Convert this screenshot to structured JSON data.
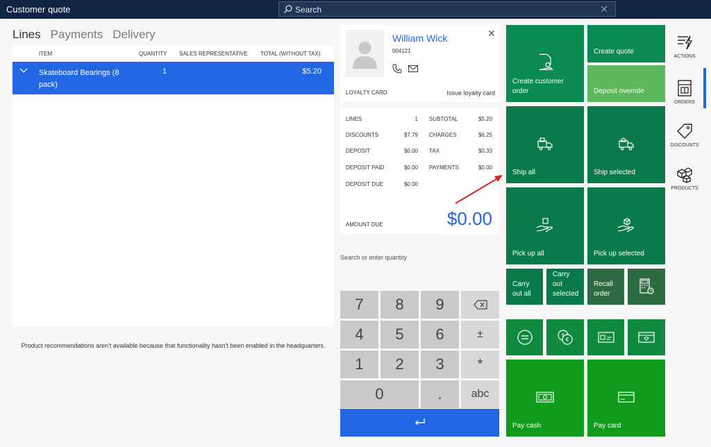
{
  "window": {
    "title": "Customer quote",
    "search_label": "Search"
  },
  "tabs": [
    "Lines",
    "Payments",
    "Delivery"
  ],
  "lines": {
    "columns": [
      "Item",
      "Quantity",
      "Sales representative",
      "Total (without tax)"
    ],
    "rows": [
      {
        "item": "Skateboard Bearings (8 pack)",
        "quantity": "1",
        "rep": "",
        "total": "$5.20"
      }
    ],
    "recommendation_note": "Product recommendations aren't available because that functionality hasn't been enabled in the headquarters."
  },
  "customer": {
    "name": "William Wick",
    "id": "004121",
    "loyalty_label": "Loyalty card",
    "issue_label": "Issue loyalty card"
  },
  "totals": {
    "lines_label": "Lines",
    "lines": "1",
    "discounts_label": "Discounts",
    "discounts": "$7.79",
    "deposit_label": "Deposit",
    "deposit": "$0.00",
    "deposit_paid_label": "Deposit paid",
    "deposit_paid": "$0.00",
    "deposit_due_label": "Deposit due",
    "deposit_due": "$0.00",
    "subtotal_label": "Subtotal",
    "subtotal": "$5.20",
    "charges_label": "Charges",
    "charges": "$6.25",
    "tax_label": "Tax",
    "tax": "$0.33",
    "payments_label": "Payments",
    "payments": "$0.00",
    "amount_due_label": "Amount due",
    "amount_due": "$0.00"
  },
  "numpad": {
    "hint": "Search or enter quantity",
    "keys": [
      "7",
      "8",
      "9",
      "4",
      "5",
      "6",
      "±",
      "1",
      "2",
      "3",
      "*",
      "0",
      ".",
      "abc"
    ]
  },
  "tiles": {
    "create_customer_order": "Create customer order",
    "create_quote": "Create quote",
    "deposit_override": "Deposit override",
    "ship_all": "Ship all",
    "ship_selected": "Ship selected",
    "pick_up_all": "Pick up all",
    "pick_up_selected": "Pick up selected",
    "carry_out_all": "Carry out all",
    "carry_out_selected": "Carry out selected",
    "recall_order": "Recall order",
    "pay_cash": "Pay cash",
    "pay_card": "Pay card"
  },
  "rail": {
    "actions": "Actions",
    "orders": "Orders",
    "discounts": "Discounts",
    "products": "Products"
  },
  "colors": {
    "titlebar": "#0f2443",
    "accent": "#2266e3",
    "tile_dark_green": "#0b7a4b",
    "tile_green": "#108a3e",
    "tile_bright_green": "#109b1c",
    "tile_light_green": "#5cb85c"
  }
}
